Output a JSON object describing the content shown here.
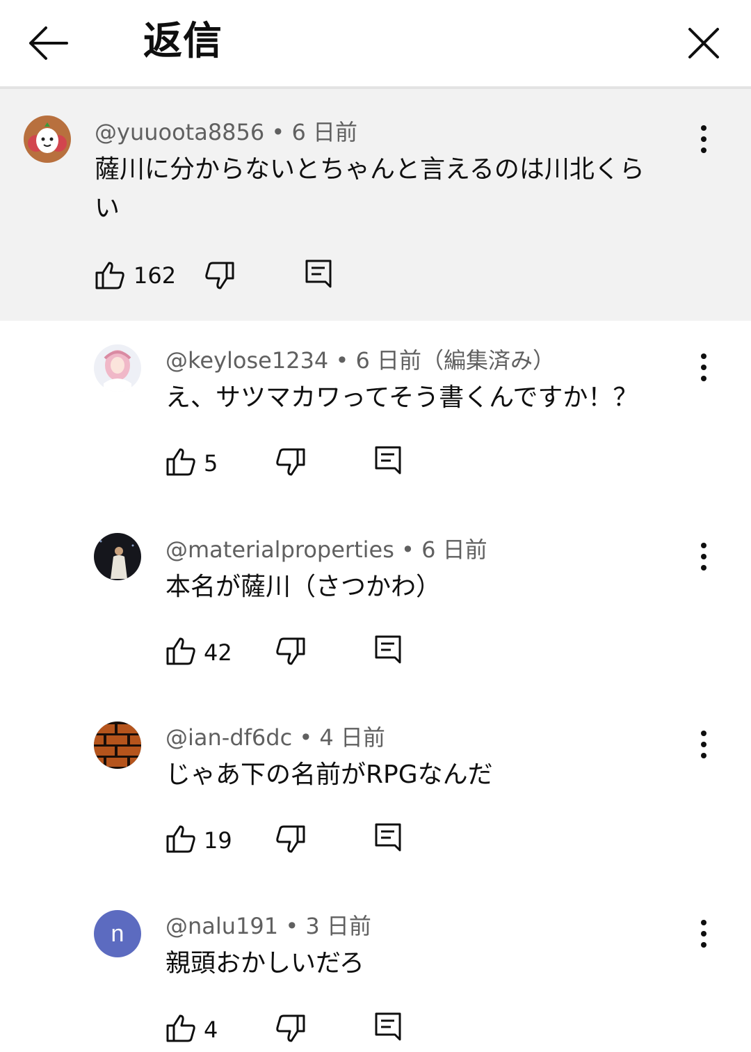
{
  "header": {
    "title": "返信"
  },
  "parent_comment": {
    "meta": "@yuuoota8856 • 6 日前",
    "text_line1": "薩川に分からないとちゃんと言えるのは川北くら",
    "text_line2": "い",
    "likes": "162"
  },
  "replies": [
    {
      "meta": "@keylose1234 • 6 日前（編集済み）",
      "text": "え、サツマカワってそう書くんですか！？",
      "likes": "5"
    },
    {
      "meta": "@materialproperties • 6 日前",
      "text": "本名が薩川（さつかわ）",
      "likes": "42"
    },
    {
      "meta": "@ian-df6dc • 4 日前",
      "text": "じゃあ下の名前がRPGなんだ",
      "likes": "19"
    },
    {
      "meta": "@nalu191 • 3 日前",
      "text": "親頭おかしいだろ",
      "likes": "4",
      "avatar_letter": "n"
    }
  ],
  "icons": {
    "back": "back-arrow-icon",
    "close": "close-icon",
    "like": "thumbs-up-icon",
    "dislike": "thumbs-down-icon",
    "reply": "comment-reply-icon",
    "more": "more-vert-icon"
  },
  "colors": {
    "parent_bg": "#f2f2f2",
    "meta_text": "#606060",
    "avatar_n_bg": "#5c6bc0"
  }
}
